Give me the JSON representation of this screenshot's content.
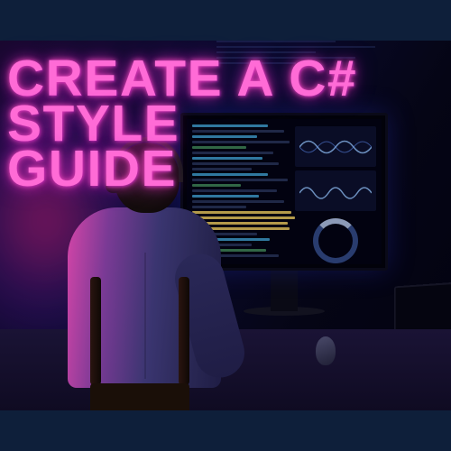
{
  "headline": {
    "line1": "CREATE A C# STYLE",
    "line2": "GUIDE"
  },
  "colors": {
    "background": "#0e1f3a",
    "headline": "#ff6bd6",
    "glow": "#ff28aa"
  }
}
